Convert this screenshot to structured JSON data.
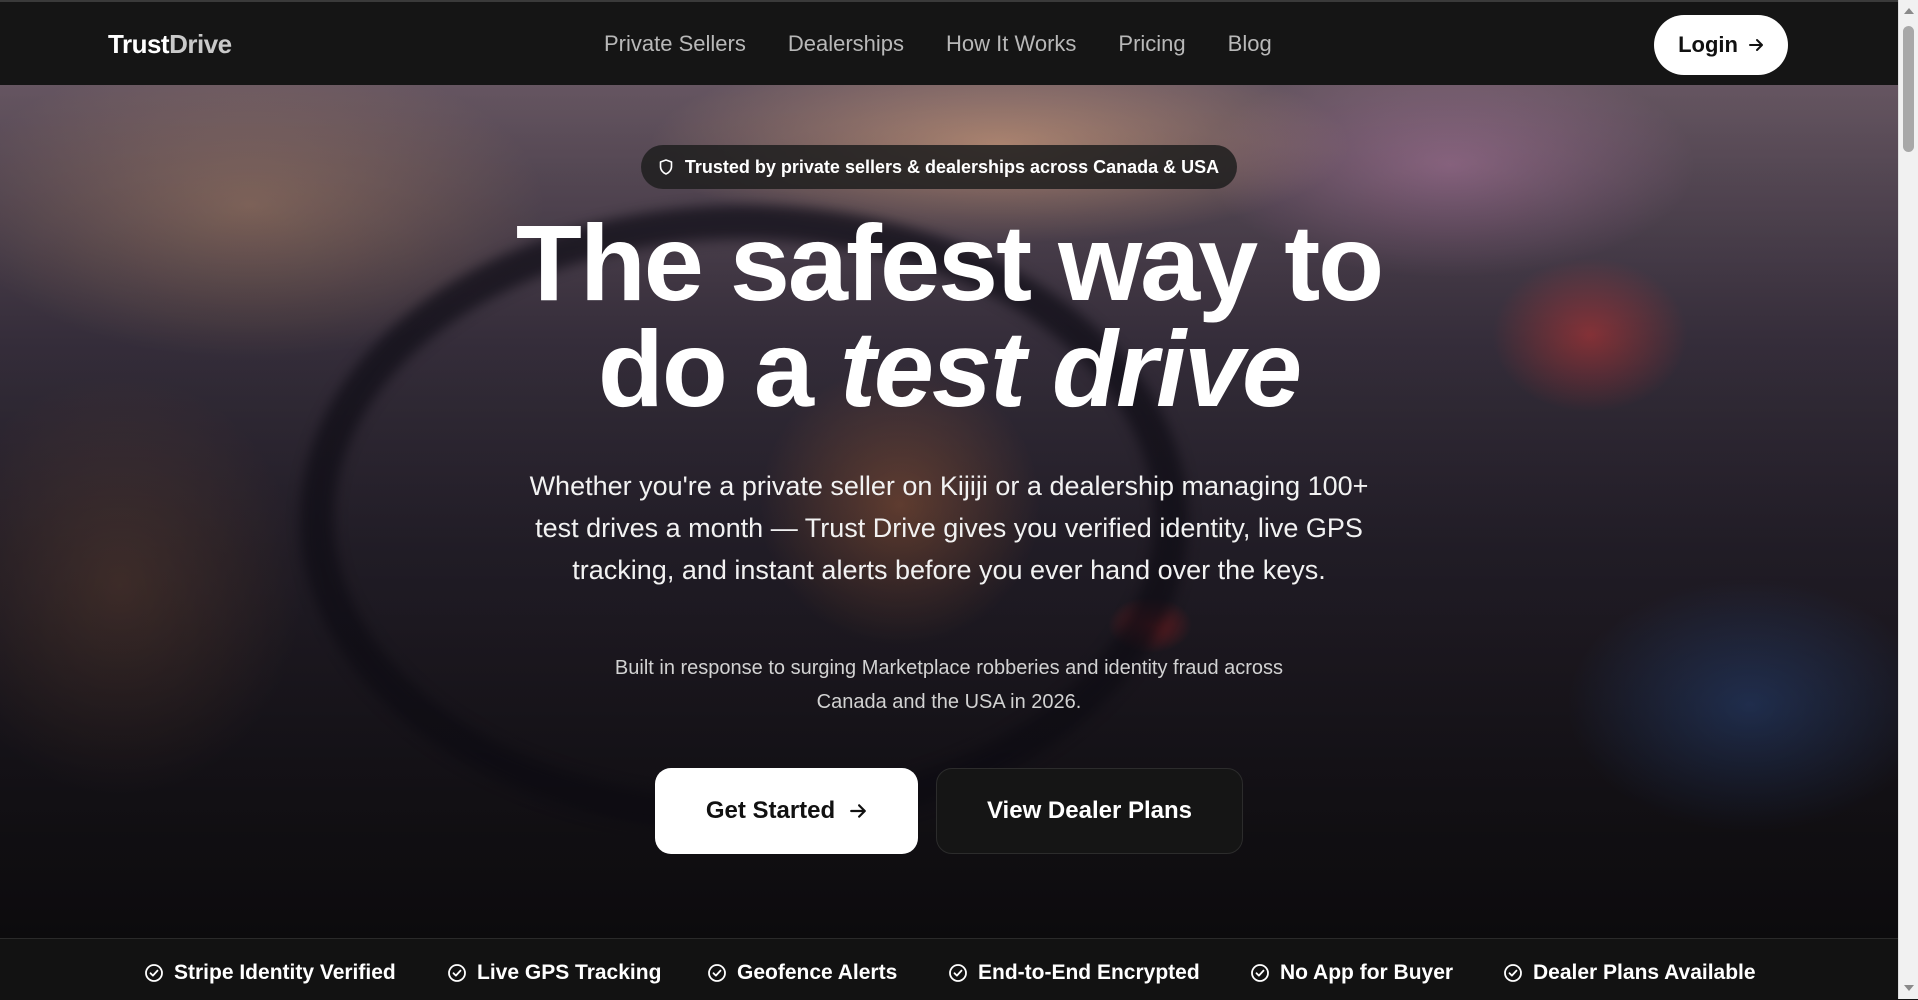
{
  "nav": {
    "logo_primary": "Trust",
    "logo_secondary": "Drive",
    "links": [
      "Private Sellers",
      "Dealerships",
      "How It Works",
      "Pricing",
      "Blog"
    ],
    "login_label": "Login"
  },
  "hero": {
    "badge_text": "Trusted by private sellers & dealerships across Canada & USA",
    "headline_line1": "The safest way to",
    "headline_line2_plain": "do a ",
    "headline_line2_italic": "test drive",
    "subheading": "Whether you're a private seller on Kijiji or a dealership managing 100+ test drives a month — Trust Drive gives you verified identity, live GPS tracking, and instant alerts before you ever hand over the keys.",
    "note": "Built in response to surging Marketplace robberies and identity fraud across Canada and the USA in 2026.",
    "cta_primary": "Get Started",
    "cta_secondary": "View Dealer Plans"
  },
  "features": [
    "Stripe Identity Verified",
    "Live GPS Tracking",
    "Geofence Alerts",
    "End-to-End Encrypted",
    "No App for Buyer",
    "Dealer Plans Available"
  ],
  "icons": {
    "badge": "shield-icon",
    "login": "arrow-right-icon",
    "cta": "arrow-right-icon",
    "features": "check-circle-icon"
  }
}
